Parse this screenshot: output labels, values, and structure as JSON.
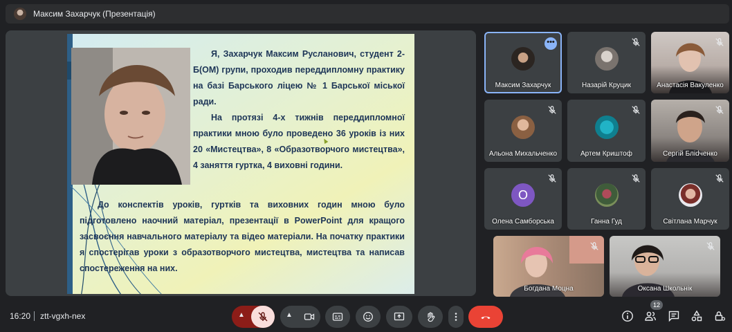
{
  "header": {
    "presenter_title": "Максим Захарчук (Презентація)"
  },
  "slide": {
    "para1": [
      "Я, Захарчук Максим Русланович, студент 2-Б(ОМ) групи, проходив переддипломну практику на базі Барського ліцею № 1 Барської міської ради.",
      "На протязі 4-х тижнів переддипломної практики мною було проведено 36 уроків із них 20 «Мистецтва», 8 «Образотворчого мистецтва», 4 заняття гуртка, 4 виховні години."
    ],
    "para2": "До конспектів уроків, гуртків та виховних годин мною було підготовлено наочний матеріал, презентації в PowerPoint для кращого засвоєння навчального матеріалу та відео матеріали. На початку практики я спостерігав уроки з образотворчого мистецтва, мистецтва та написав спостереження на них."
  },
  "participants": [
    {
      "name": "Максим Захарчук",
      "muted": false,
      "active": true
    },
    {
      "name": "Назарій Круцик",
      "muted": true
    },
    {
      "name": "Анастасія Вакуленко",
      "muted": true
    },
    {
      "name": "Альона Михальченко",
      "muted": true
    },
    {
      "name": "Артем Криштоф",
      "muted": true
    },
    {
      "name": "Сергій Бліdченко",
      "muted": true
    },
    {
      "name": "Олена Самборська",
      "muted": true,
      "initial": "О"
    },
    {
      "name": "Ганна Гуд",
      "muted": true
    },
    {
      "name": "Світлана Марчук",
      "muted": true
    },
    {
      "name": "Богдана Моцна",
      "muted": true
    },
    {
      "name": "Оксана Школьнік",
      "muted": true
    }
  ],
  "footer": {
    "clock": "16:20",
    "meeting_code": "ztt-vgxh-nex",
    "people_count": "12"
  },
  "colors": {
    "accent": "#8ab4f8",
    "mic_off_bg": "#f9dedc",
    "mic_off_fg": "#601410",
    "hangup": "#ea4335",
    "slide_text": "#1d3557"
  }
}
